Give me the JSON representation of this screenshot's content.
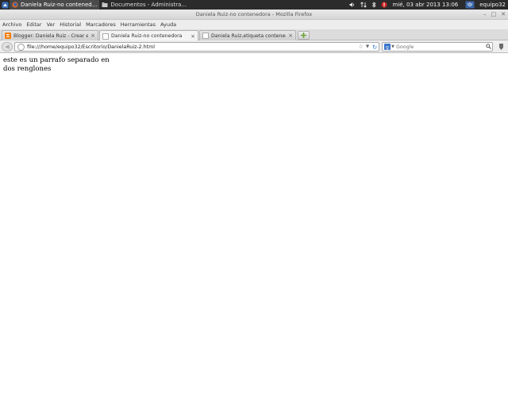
{
  "panel": {
    "tasks": [
      {
        "label": "Daniela Ruiz-no contened...",
        "active": true
      },
      {
        "label": "Documentos - Administra...",
        "active": false
      }
    ],
    "clock": "mié, 03 abr 2013 13:06",
    "user": "equipo32",
    "colors": {
      "background": "#2b2b2b",
      "battery_red": "#cc2222"
    }
  },
  "window": {
    "title": "Daniela Ruiz-no contenedora - Mozilla Firefox"
  },
  "menu": {
    "items": [
      "Archivo",
      "Editar",
      "Ver",
      "Historial",
      "Marcadores",
      "Herramientas",
      "Ayuda"
    ]
  },
  "tabs": [
    {
      "label": "Blogger: Daniela Ruiz - Crear ent...",
      "icon": "blogger-icon",
      "selected": false
    },
    {
      "label": "Daniela Ruiz-no contenedora",
      "icon": "page-icon",
      "selected": true
    },
    {
      "label": "Daniela Ruiz,etiqueta contened...",
      "icon": "page-icon",
      "selected": false
    }
  ],
  "nav": {
    "url": "file:///home/equipo32/Escritorio/DanielaRuiz-2.html",
    "search_placeholder": "Google"
  },
  "content": {
    "lines": [
      "este es un parrafo separado en",
      "dos renglones"
    ]
  }
}
